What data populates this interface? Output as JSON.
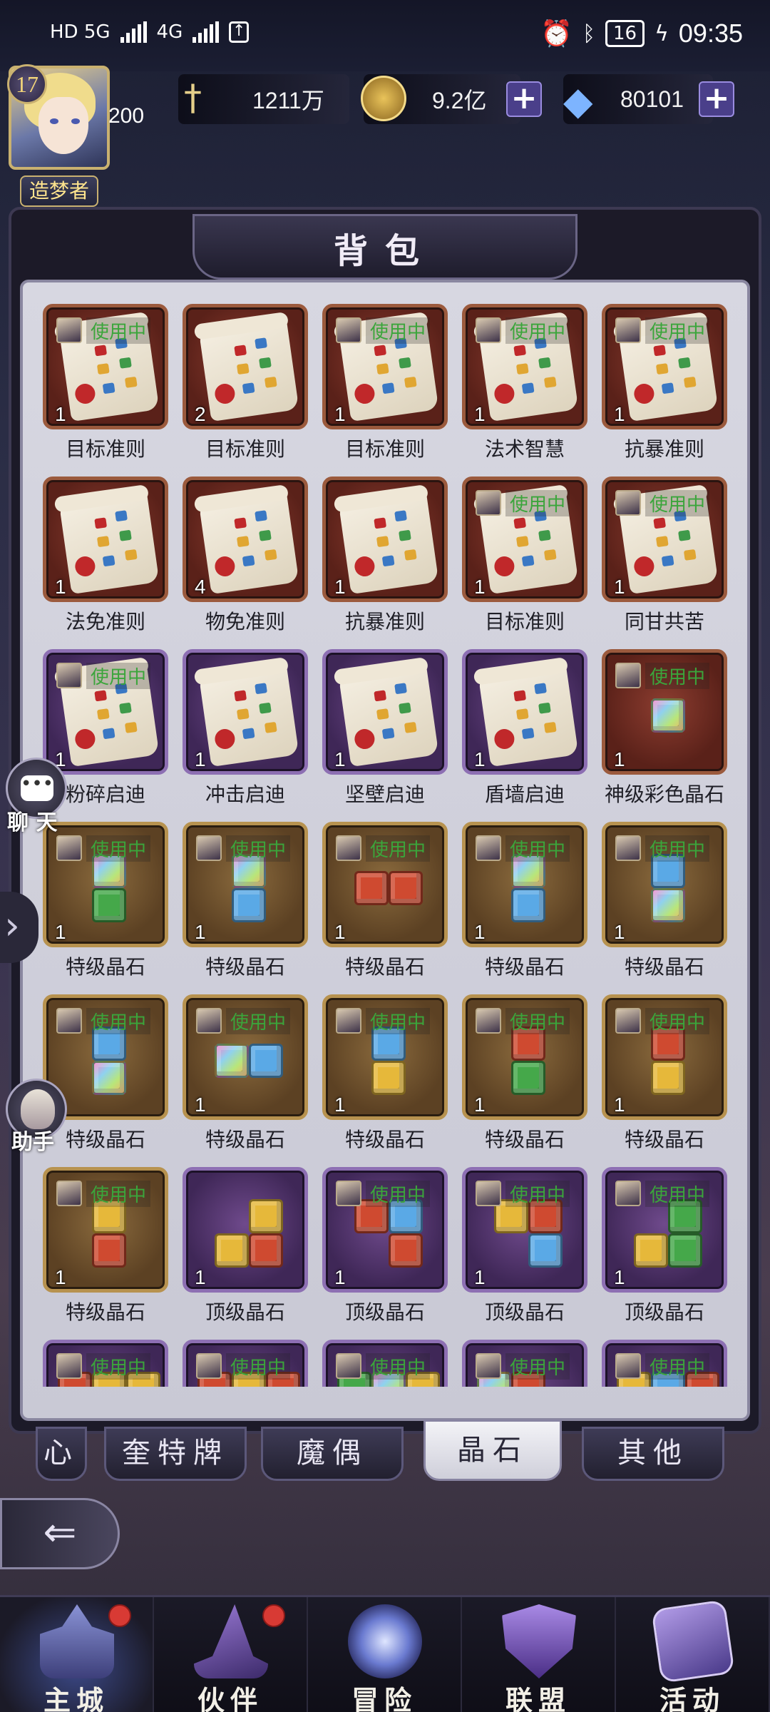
{
  "status_bar": {
    "network_left": "HD 5G",
    "network_right": "4G",
    "battery": "16",
    "time": "09:35"
  },
  "player": {
    "level": "17",
    "level_value": "200",
    "title": "造梦者",
    "stars": "◆◆◆◆◆"
  },
  "resources": {
    "power": "1211万",
    "gold": "9.2亿",
    "diamonds": "80101"
  },
  "panel": {
    "title": "背包"
  },
  "items": [
    {
      "name": "目标准则",
      "count": "1",
      "frame": "red",
      "kind": "scroll",
      "in_use": true
    },
    {
      "name": "目标准则",
      "count": "2",
      "frame": "red",
      "kind": "scroll",
      "in_use": false
    },
    {
      "name": "目标准则",
      "count": "1",
      "frame": "red",
      "kind": "scroll",
      "in_use": true
    },
    {
      "name": "法术智慧",
      "count": "1",
      "frame": "red",
      "kind": "scroll",
      "in_use": true
    },
    {
      "name": "抗暴准则",
      "count": "1",
      "frame": "red",
      "kind": "scroll",
      "in_use": true
    },
    {
      "name": "法免准则",
      "count": "1",
      "frame": "red",
      "kind": "scroll",
      "in_use": false
    },
    {
      "name": "物免准则",
      "count": "4",
      "frame": "red",
      "kind": "scroll",
      "in_use": false
    },
    {
      "name": "抗暴准则",
      "count": "1",
      "frame": "red",
      "kind": "scroll",
      "in_use": false
    },
    {
      "name": "目标准则",
      "count": "1",
      "frame": "red",
      "kind": "scroll",
      "in_use": true
    },
    {
      "name": "同甘共苦",
      "count": "1",
      "frame": "red",
      "kind": "scroll",
      "in_use": true
    },
    {
      "name": "粉碎启迪",
      "count": "1",
      "frame": "purple",
      "kind": "scroll",
      "in_use": true
    },
    {
      "name": "冲击启迪",
      "count": "1",
      "frame": "purple",
      "kind": "scroll",
      "in_use": false
    },
    {
      "name": "坚壁启迪",
      "count": "1",
      "frame": "purple",
      "kind": "scroll",
      "in_use": false
    },
    {
      "name": "盾墙启迪",
      "count": "1",
      "frame": "purple",
      "kind": "scroll",
      "in_use": false
    },
    {
      "name": "神级彩色晶石",
      "count": "1",
      "frame": "red",
      "kind": "gem",
      "gems": [
        "rainbow"
      ],
      "shape": "single",
      "in_use": true
    },
    {
      "name": "特级晶石",
      "count": "1",
      "frame": "gold",
      "kind": "gem",
      "gems": [
        "rainbow",
        "green"
      ],
      "shape": "vertical",
      "in_use": true
    },
    {
      "name": "特级晶石",
      "count": "1",
      "frame": "gold",
      "kind": "gem",
      "gems": [
        "rainbow",
        "blue"
      ],
      "shape": "vertical",
      "in_use": true
    },
    {
      "name": "特级晶石",
      "count": "1",
      "frame": "gold",
      "kind": "gem",
      "gems": [
        "red",
        "red"
      ],
      "shape": "horizontal",
      "in_use": true
    },
    {
      "name": "特级晶石",
      "count": "1",
      "frame": "gold",
      "kind": "gem",
      "gems": [
        "rainbow",
        "blue"
      ],
      "shape": "vertical",
      "in_use": true
    },
    {
      "name": "特级晶石",
      "count": "1",
      "frame": "gold",
      "kind": "gem",
      "gems": [
        "blue",
        "rainbow"
      ],
      "shape": "vertical",
      "in_use": true
    },
    {
      "name": "特级晶石",
      "count": "1",
      "frame": "gold",
      "kind": "gem",
      "gems": [
        "blue",
        "rainbow"
      ],
      "shape": "vertical",
      "in_use": true
    },
    {
      "name": "特级晶石",
      "count": "1",
      "frame": "gold",
      "kind": "gem",
      "gems": [
        "rainbow",
        "blue"
      ],
      "shape": "horizontal",
      "in_use": true
    },
    {
      "name": "特级晶石",
      "count": "1",
      "frame": "gold",
      "kind": "gem",
      "gems": [
        "blue",
        "yellow"
      ],
      "shape": "vertical",
      "in_use": true
    },
    {
      "name": "特级晶石",
      "count": "1",
      "frame": "gold",
      "kind": "gem",
      "gems": [
        "red",
        "green"
      ],
      "shape": "vertical",
      "in_use": true
    },
    {
      "name": "特级晶石",
      "count": "1",
      "frame": "gold",
      "kind": "gem",
      "gems": [
        "red",
        "yellow"
      ],
      "shape": "vertical",
      "in_use": true
    },
    {
      "name": "特级晶石",
      "count": "1",
      "frame": "gold",
      "kind": "gem",
      "gems": [
        "yellow",
        "red"
      ],
      "shape": "vertical",
      "in_use": true
    },
    {
      "name": "顶级晶石",
      "count": "1",
      "frame": "purple",
      "kind": "gem",
      "gems": [
        "yellow",
        "yellow",
        "red"
      ],
      "shape": "l",
      "in_use": false
    },
    {
      "name": "顶级晶石",
      "count": "1",
      "frame": "purple",
      "kind": "gem",
      "gems": [
        "red",
        "blue",
        "red"
      ],
      "shape": "t",
      "in_use": true
    },
    {
      "name": "顶级晶石",
      "count": "1",
      "frame": "purple",
      "kind": "gem",
      "gems": [
        "yellow",
        "red",
        "blue"
      ],
      "shape": "t",
      "in_use": true
    },
    {
      "name": "顶级晶石",
      "count": "1",
      "frame": "purple",
      "kind": "gem",
      "gems": [
        "green",
        "yellow",
        "green"
      ],
      "shape": "l",
      "in_use": true
    },
    {
      "name": "",
      "count": "",
      "frame": "purple",
      "kind": "gem",
      "gems": [
        "red",
        "yellow",
        "yellow"
      ],
      "shape": "row3",
      "in_use": true
    },
    {
      "name": "",
      "count": "",
      "frame": "purple",
      "kind": "gem",
      "gems": [
        "red",
        "yellow",
        "red"
      ],
      "shape": "row3",
      "in_use": true
    },
    {
      "name": "",
      "count": "",
      "frame": "purple",
      "kind": "gem",
      "gems": [
        "green",
        "rainbow",
        "yellow"
      ],
      "shape": "row3",
      "in_use": true
    },
    {
      "name": "",
      "count": "",
      "frame": "purple",
      "kind": "gem",
      "gems": [
        "rainbow",
        "red"
      ],
      "shape": "row3",
      "in_use": true
    },
    {
      "name": "",
      "count": "",
      "frame": "purple",
      "kind": "gem",
      "gems": [
        "yellow",
        "blue",
        "red"
      ],
      "shape": "row3",
      "in_use": true
    }
  ],
  "in_use_label": "使用中",
  "side": {
    "chat": "聊 天",
    "assistant": "助手"
  },
  "tabs": [
    {
      "label": "心",
      "active": false
    },
    {
      "label": "奎特牌",
      "active": false
    },
    {
      "label": "魔偶",
      "active": false
    },
    {
      "label": "晶石",
      "active": true
    },
    {
      "label": "其他",
      "active": false
    }
  ],
  "bottom_nav": [
    {
      "label": "主城",
      "icon": "castle-icon",
      "active": true,
      "badge": true
    },
    {
      "label": "伙伴",
      "icon": "witch-hat-icon",
      "active": false,
      "badge": true
    },
    {
      "label": "冒险",
      "icon": "compass-icon",
      "active": false,
      "badge": false
    },
    {
      "label": "联盟",
      "icon": "shield-icon",
      "active": false,
      "badge": false
    },
    {
      "label": "活动",
      "icon": "cards-icon",
      "active": false,
      "badge": false
    }
  ],
  "colors": {
    "in_use": "#3ba53b",
    "badge": "#d83a34",
    "gold": "#c9b170"
  }
}
